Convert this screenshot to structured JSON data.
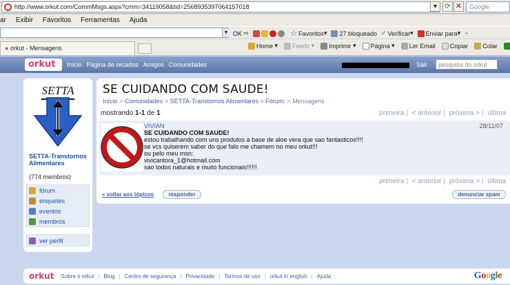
{
  "browser": {
    "url": "http://www.orkut.com/CommMsgs.aspx?cmm=34119058&tid=2568935397064157018",
    "search_placeholder": "Google",
    "menu": [
      "ar",
      "Exibir",
      "Favoritos",
      "Ferramentas",
      "Ajuda"
    ],
    "links_bar": [
      "OK",
      "Favoritos",
      "27 bloqueado",
      "Verificar",
      "Enviar para"
    ],
    "tab_title": "orkut - Mensagens",
    "commands": [
      "Home",
      "Feeds",
      "Imprimir",
      "Página",
      "Ler Email",
      "Copiar",
      "Colar",
      "Ta"
    ]
  },
  "orkut": {
    "logo": "orkut",
    "nav": [
      "Início",
      "Página de recados",
      "Amigos",
      "Comunidades"
    ],
    "sair": "Sair",
    "search_placeholder": "pesquisa do orkut"
  },
  "sidebar": {
    "logo_text": "SETTA",
    "community_name": "SETTA-Transtornos Alimentares",
    "members": "(774 membros)",
    "menu": [
      {
        "label": "fórum",
        "icon": "forum-icon",
        "color": "#d9a43a"
      },
      {
        "label": "enquetes",
        "icon": "polls-icon",
        "color": "#c98a2a"
      },
      {
        "label": "eventos",
        "icon": "events-icon",
        "color": "#5a7fc0"
      },
      {
        "label": "membros",
        "icon": "members-icon",
        "color": "#4e9a3a"
      }
    ],
    "profile": {
      "label": "ver perfil",
      "icon": "profile-icon",
      "color": "#8a5bb5"
    }
  },
  "topic": {
    "title": "SE CUIDANDO COM SAUDE!",
    "breadcrumb": {
      "inicio": "Início",
      "comunidades": "Comunidades",
      "community": "SETTA-Transtornos Alimentares",
      "forum": "Fórum:",
      "current": "Mensagens"
    },
    "showing_prefix": "mostrando ",
    "showing_range": "1-1",
    "showing_of": " de ",
    "showing_total": "1",
    "pager": [
      "primeira",
      "< anterior",
      "próxima >",
      "última"
    ]
  },
  "message": {
    "author": "VIVIAN",
    "date": "28/11/07",
    "subject": "SE CUIDANDO COM SAUDE!",
    "lines": [
      "estou trabalhando com uns produtos à base de aloe vera que sao fantasticos!!!!",
      "se vcs quiserem saber do que falo me chamem no meu orkut!!!",
      "ou pelo meu msn:",
      "vivicantora_1@hotmail.com",
      "sao todos naturais e muito funcionais!!!!!!"
    ]
  },
  "actions": {
    "back": "« voltar aos tópicos",
    "reply": "responder",
    "report": "denunciar spam"
  },
  "footer": {
    "logo": "orkut",
    "links": [
      "Sobre o orkut",
      "Blog",
      "Centro de segurança",
      "Privacidade",
      "Termos de uso",
      "orkut in english",
      "Ajuda"
    ],
    "google": "Google"
  },
  "colors": {
    "orkut_pink": "#e0397a",
    "header_blue": "#6d84b4",
    "link_blue": "#3b5ea0",
    "page_bg": "#c9d6ee"
  }
}
